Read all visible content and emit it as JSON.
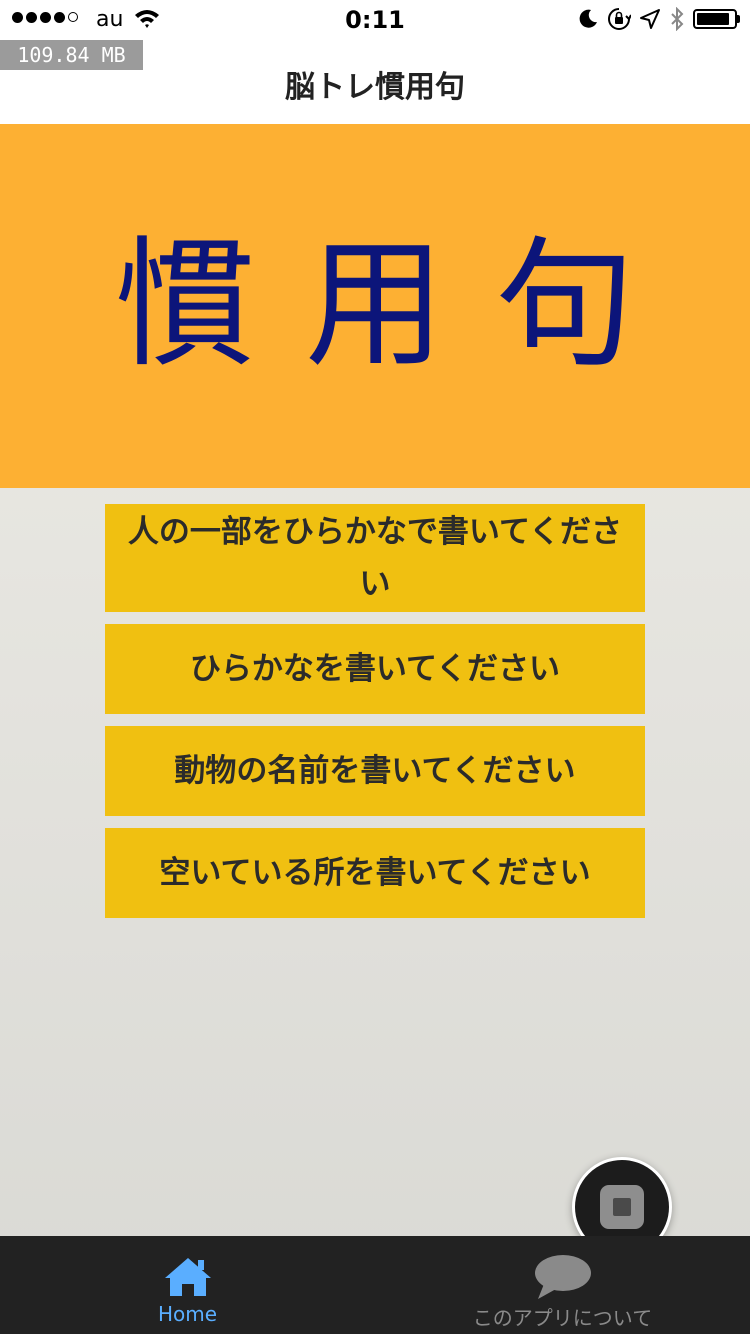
{
  "status_bar": {
    "carrier": "au",
    "time": "0:11",
    "signal_bars_filled": 4,
    "signal_bars_total": 5
  },
  "memory_overlay": "109.84 MB",
  "nav": {
    "title": "脳トレ慣用句"
  },
  "hero": {
    "text": "慣用句"
  },
  "menu": {
    "items": [
      {
        "label": "人の一部をひらかなで書いてください"
      },
      {
        "label": "ひらかなを書いてください"
      },
      {
        "label": "動物の名前を書いてください"
      },
      {
        "label": "空いている所を書いてください"
      }
    ]
  },
  "tabs": [
    {
      "label": "Home",
      "icon": "home-icon",
      "active": true
    },
    {
      "label": "このアプリについて",
      "icon": "chat-bubble-icon",
      "active": false
    }
  ],
  "colors": {
    "hero_background": "#fdb033",
    "hero_text": "#0c157a",
    "button_background": "#f0c011",
    "tab_active": "#5aaeff",
    "tab_inactive": "#8a8a8a",
    "tabbar_background": "#222222"
  }
}
